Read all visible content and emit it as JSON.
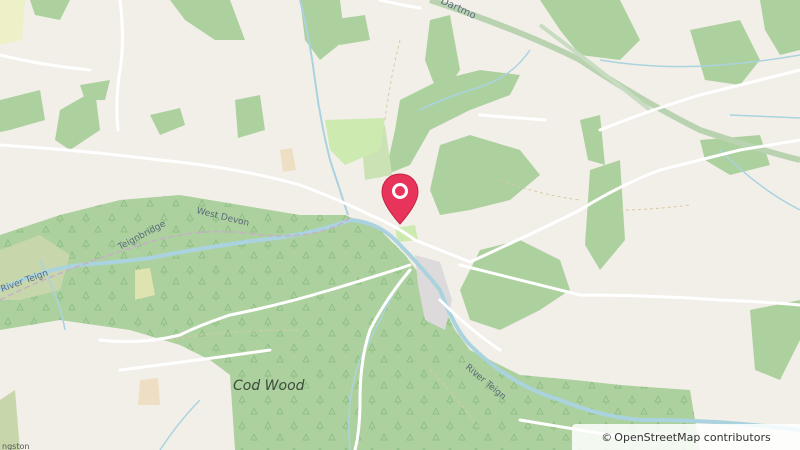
{
  "map": {
    "labels": {
      "west_devon": "West Devon",
      "teignbridge": "Teignbridge",
      "river_teign_west": "River Teign",
      "river_teign_east": "River Teign",
      "cod_wood": "Cod Wood",
      "dartmoor": "Dartmo",
      "corner_label": "ngston"
    },
    "marker": {
      "type": "location-pin",
      "color": "#e8345a"
    },
    "attribution": {
      "symbol": "©",
      "text": "OpenStreetMap contributors"
    },
    "colors": {
      "land": "#f2efe9",
      "woodland": "#a9d19c",
      "river": "#aad3df",
      "road": "#ffffff",
      "boundary": "#c9b7c9"
    }
  }
}
